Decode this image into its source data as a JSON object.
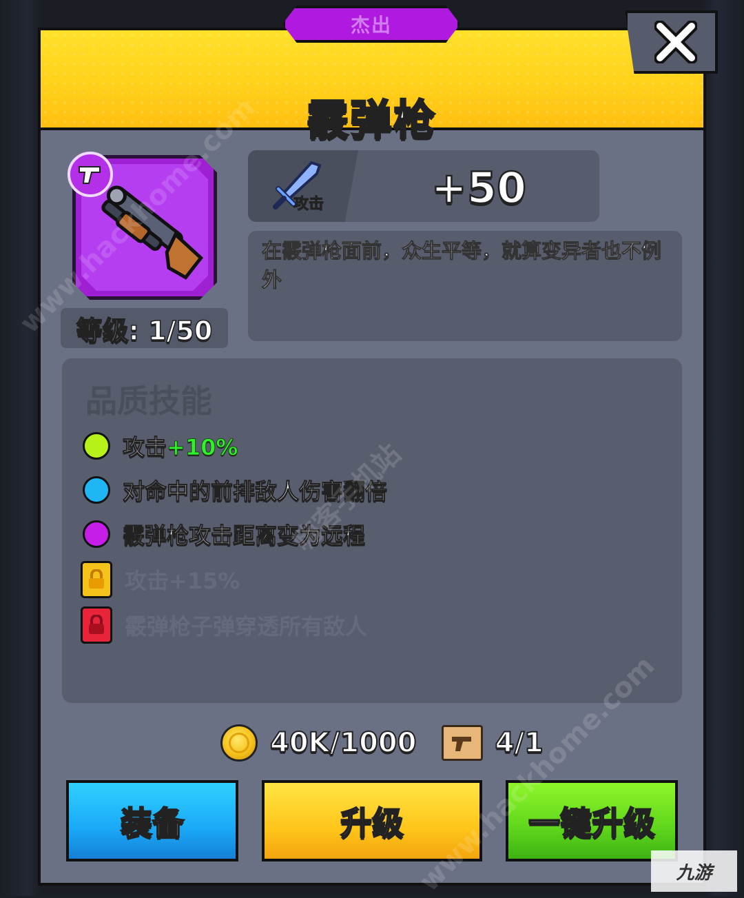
{
  "dialog": {
    "quality_tag": "杰出",
    "title": "霰弹枪",
    "close_label": "✕"
  },
  "weapon": {
    "level_text": "等级: 1/50",
    "stat": {
      "icon": "sword-icon",
      "label": "攻击",
      "value": "+50"
    },
    "description": "在霰弹枪面前，众生平等，就算变异者也不例外"
  },
  "skills": {
    "title": "品质技能",
    "items": [
      {
        "text": "攻击",
        "bonus": "+10%",
        "color": "#b6f11a",
        "locked": false
      },
      {
        "text": "对命中的前排敌人伤害翻倍",
        "bonus": "",
        "color": "#1fb6f5",
        "locked": false
      },
      {
        "text": "霰弹枪攻击距离变为远程",
        "bonus": "",
        "color": "#c61de8",
        "locked": false
      },
      {
        "text": "攻击+15%",
        "bonus": "",
        "color": "#f5c21a",
        "locked": true
      },
      {
        "text": "霰弹枪子弹穿透所有敌人",
        "bonus": "",
        "color": "#e8243a",
        "locked": true
      }
    ]
  },
  "cost": {
    "gold": "40K/1000",
    "scroll": "4/1"
  },
  "buttons": {
    "equip": "装备",
    "upgrade": "升级",
    "auto_upgrade": "一键升级"
  },
  "watermarks": [
    "www.hackhome.com",
    "嗨客手机站",
    "www.hackhome.com"
  ],
  "corner_logo": "九游",
  "colors": {
    "header_yellow": "#ffd11a",
    "epic_purple": "#b019e0",
    "panel": "#6b7184"
  }
}
